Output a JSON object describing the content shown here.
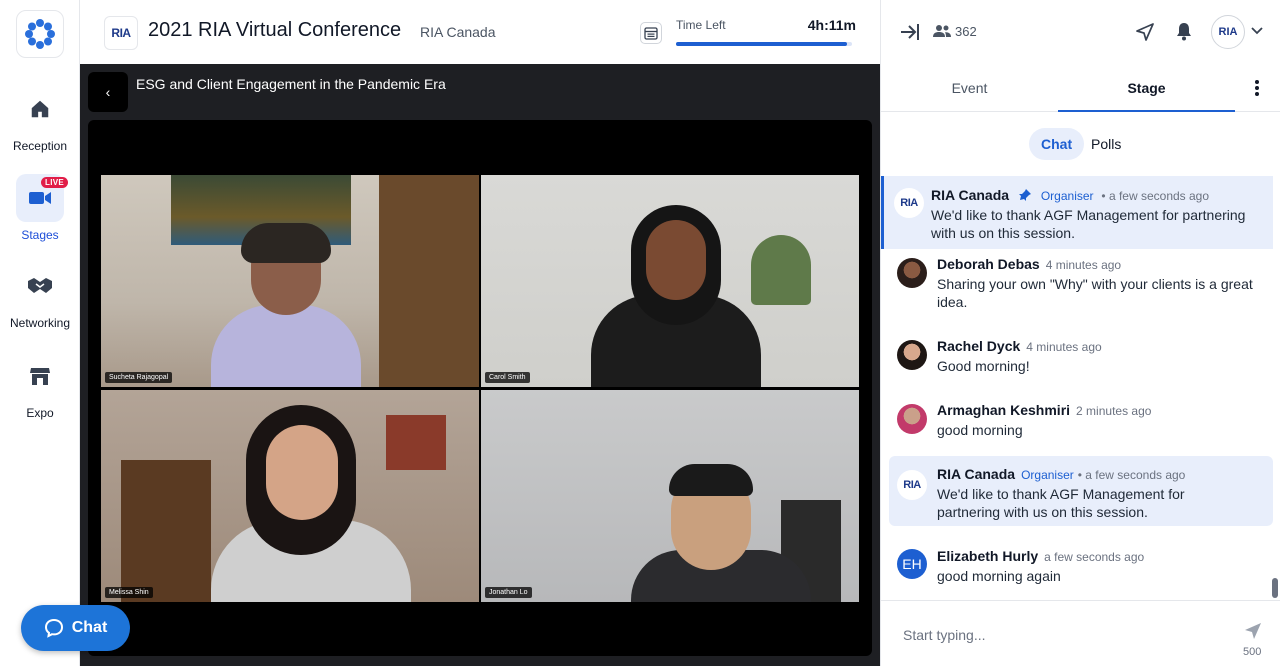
{
  "nav": {
    "items": [
      {
        "label": "Reception",
        "icon": "home-icon"
      },
      {
        "label": "Stages",
        "icon": "video-camera-icon",
        "badge": "LIVE"
      },
      {
        "label": "Networking",
        "icon": "handshake-icon"
      },
      {
        "label": "Expo",
        "icon": "store-icon"
      }
    ],
    "chat_button": "Chat"
  },
  "header": {
    "logo": "RIA",
    "title": "2021 RIA Virtual Conference",
    "org": "RIA Canada",
    "time_left_label": "Time Left",
    "time_left_value": "4h:11m",
    "time_progress_fraction": 0.97
  },
  "stage": {
    "session_title": "ESG and Client Engagement in the Pandemic Era",
    "back_glyph": "‹",
    "participants": [
      {
        "name": "Sucheta Rajagopal"
      },
      {
        "name": "Carol Smith"
      },
      {
        "name": "Melissa Shin"
      },
      {
        "name": "Jonathan Lo"
      }
    ]
  },
  "panel": {
    "attendee_count": "362",
    "avatar_text": "RIA",
    "tabs": [
      "Event",
      "Stage"
    ],
    "subtabs": [
      "Chat",
      "Polls"
    ],
    "messages": [
      {
        "author": "RIA Canada",
        "role": "Organiser",
        "time": "• a few seconds ago",
        "text": "We'd like to thank AGF Management for partnering with us on this session.",
        "avatar": "RIA"
      },
      {
        "author": "Deborah Debas",
        "time": "4 minutes ago",
        "text": "Sharing your own \"Why\" with your clients is a great idea."
      },
      {
        "author": "Rachel Dyck",
        "time": "4 minutes ago",
        "text": "Good morning!"
      },
      {
        "author": "Armaghan Keshmiri",
        "time": "2 minutes ago",
        "text": "good morning"
      },
      {
        "author": "RIA Canada",
        "role": "Organiser",
        "time": "• a few seconds ago",
        "text": "We'd like to thank AGF Management for partnering with us on this session.",
        "avatar": "RIA"
      },
      {
        "author": "Elizabeth Hurly",
        "time": "a few seconds ago",
        "text": "good morning again",
        "avatar": "EH"
      }
    ],
    "input_placeholder": "Start typing...",
    "char_limit": "500"
  },
  "colors": {
    "accent": "#1d5fd1",
    "live_badge": "#e11d48",
    "chat_fab": "#1d74d8",
    "stage_bg": "#1e1f23"
  }
}
